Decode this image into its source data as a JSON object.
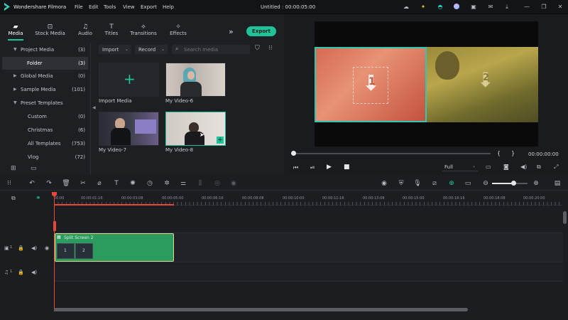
{
  "app": {
    "name": "Wondershare Filmora",
    "title": "Untitled : 00:00:05:00"
  },
  "menu": [
    "File",
    "Edit",
    "Tools",
    "View",
    "Export",
    "Help"
  ],
  "tabs": [
    {
      "label": "Media",
      "icon": "folder-icon",
      "active": true
    },
    {
      "label": "Stock Media",
      "icon": "stock-icon"
    },
    {
      "label": "Audio",
      "icon": "music-note-icon"
    },
    {
      "label": "Titles",
      "icon": "text-t-icon"
    },
    {
      "label": "Transitions",
      "icon": "transition-icon"
    },
    {
      "label": "Effects",
      "icon": "effects-icon"
    }
  ],
  "export_label": "Export",
  "media_tree": [
    {
      "label": "Project Media",
      "count": "(3)",
      "expanded": true
    },
    {
      "label": "Folder",
      "count": "(3)",
      "selected": true
    },
    {
      "label": "Global Media",
      "count": "(0)"
    },
    {
      "label": "Sample Media",
      "count": "(101)"
    },
    {
      "label": "Preset Templates",
      "count": "",
      "expanded": true
    },
    {
      "label": "Custom",
      "count": "(0)"
    },
    {
      "label": "Christmas",
      "count": "(6)"
    },
    {
      "label": "All Templates",
      "count": "(753)"
    },
    {
      "label": "Vlog",
      "count": "(72)"
    }
  ],
  "media_toolbar": {
    "import": "Import",
    "record": "Record",
    "search_placeholder": "Search media"
  },
  "media_items": [
    {
      "label": "Import Media"
    },
    {
      "label": "My Video-6"
    },
    {
      "label": "My Video-7"
    },
    {
      "label": "My Video-8"
    }
  ],
  "preview": {
    "timecode": "00:00:00:00",
    "quality": "Full",
    "split_numbers": [
      "1",
      "2"
    ]
  },
  "ruler_ticks": [
    "00:00",
    "00:00:01:16",
    "00:00:03:08",
    "00:00:05:00",
    "00:00:06:16",
    "00:00:08:08",
    "00:00:10:00",
    "00:00:11:16",
    "00:00:13:08",
    "00:00:15:00",
    "00:00:16:16",
    "00:00:18:08",
    "00:00:20:00"
  ],
  "clip": {
    "label": "Split Screen 2",
    "cells": [
      "1",
      "2"
    ]
  },
  "tracks": [
    {
      "num": "1",
      "type": "video"
    },
    {
      "num": "1",
      "type": "audio"
    }
  ],
  "colors": {
    "accent": "#1fc39a",
    "clip": "#2c9b5e",
    "playhead": "#e8473c",
    "clip_border": "#e2d98a"
  }
}
